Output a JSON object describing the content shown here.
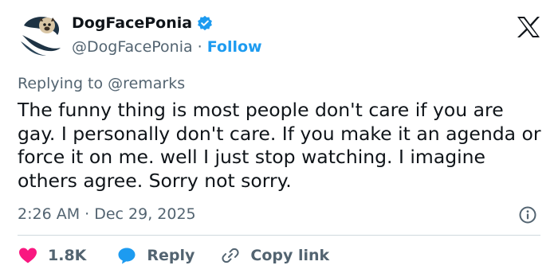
{
  "author": {
    "display_name": "DogFacePonia",
    "handle": "@DogFacePonia",
    "separator": "·",
    "follow_label": "Follow",
    "verified": true
  },
  "platform_icon": "x-logo-icon",
  "replying_to": {
    "prefix": "Replying to",
    "mention": "@remarks"
  },
  "tweet": {
    "text": "The funny thing is most people don't care if you are gay. I personally don't care. If you make it an agenda or force it on me. well I just stop watching. I imagine others agree. Sorry not sorry.",
    "timestamp": "2:26 AM · Dec 29, 2025"
  },
  "actions": {
    "likes_count": "1.8K",
    "reply_label": "Reply",
    "copy_link_label": "Copy link"
  },
  "colors": {
    "text": "#0f1419",
    "secondary": "#536471",
    "accent": "#1d9bf0",
    "like": "#f91880",
    "divider": "#cfd9de"
  }
}
